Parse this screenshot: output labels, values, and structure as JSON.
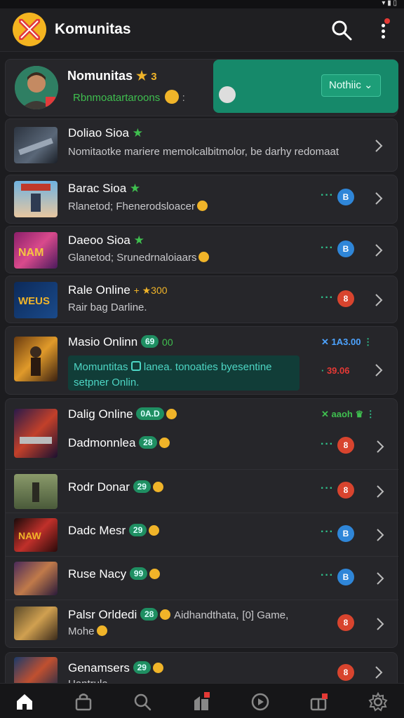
{
  "appbar": {
    "title": "Komunitas"
  },
  "profile": {
    "name": "Nomunitas",
    "badge": "3",
    "subtitle": "Rbnmoatartaroons",
    "notif_label": "Nothiic"
  },
  "items": [
    {
      "title": "Doliao Sioa",
      "sub": "Nomitaotke mariere memolcalbitmolor, be darhy redomaat"
    },
    {
      "title": "Barac Sioa",
      "sub": "Rlanetod; Fhenerodsloacer"
    },
    {
      "title": "Daeoo Sioa",
      "sub": "Glanetod; Srunedrnaloiaars"
    },
    {
      "title": "Rale Online",
      "extra": "+ ★300",
      "sub": "Rair bag Darline."
    },
    {
      "title": "Masio Onlinn",
      "tag": "69",
      "extra": "00",
      "right": "✕ 1A3.00",
      "right2": "39.06",
      "hl_line1": "Momuntitas",
      "hl_line1b": "lanea. tonoaties byesentine",
      "hl_line2": "setpner Onlin."
    }
  ],
  "group": {
    "header": {
      "title": "Dalig Online",
      "tag": "0A.D",
      "right": "✕ aaoh"
    },
    "rows": [
      {
        "title": "Dadmonnlea",
        "tag": "28",
        "pill": "8",
        "color": "red"
      },
      {
        "title": "Rodr Donar",
        "tag": "29",
        "pill": "8",
        "color": "red"
      },
      {
        "title": "Dadc Mesr",
        "tag": "29",
        "pill": "B",
        "color": "blue"
      },
      {
        "title": "Ruse Nacy",
        "tag": "99",
        "pill": "B",
        "color": "blue"
      },
      {
        "title": "Palsr Orldedi",
        "tag": "28",
        "extra": "Aidhandthata,",
        "extra2": "[0] Game,",
        "sub": "Mohe",
        "pill": "8",
        "color": "red"
      }
    ]
  },
  "last": {
    "title": "Genamsers",
    "tag": "29",
    "sub": "Hantrula",
    "pill": "8"
  },
  "pills": {
    "barac": "B",
    "daeoo": "B",
    "rale": "8"
  },
  "nav": [
    "home-icon",
    "bag-icon",
    "search-icon",
    "store-icon",
    "play-icon",
    "gift-icon",
    "settings-icon"
  ]
}
